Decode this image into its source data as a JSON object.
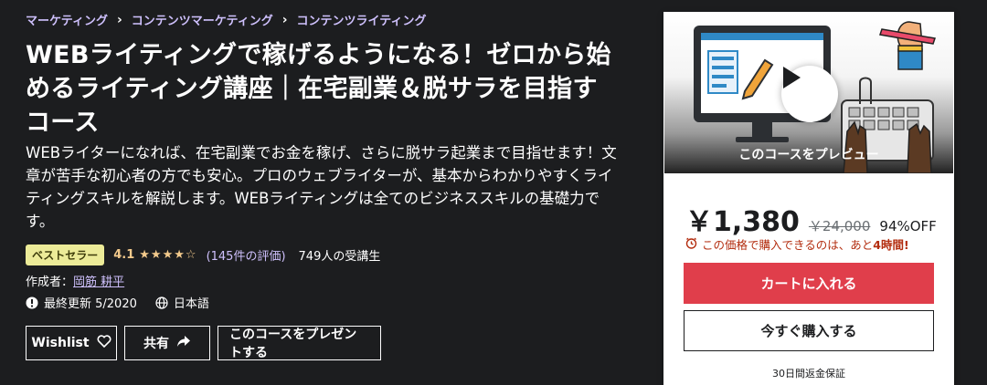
{
  "breadcrumb": [
    "マーケティング",
    "コンテンツマーケティング",
    "コンテンツライティング"
  ],
  "course": {
    "title": "WEBライティングで稼げるようになる！ゼロから始めるライティング講座｜在宅副業＆脱サラを目指すコース",
    "description": "WEBライターになれば、在宅副業でお金を稼げ、さらに脱サラ起業まで目指せます！文章が苦手な初心者の方でも安心。プロのウェブライターが、基本からわかりやすくライティングスキルを解説します。WEBライティングは全てのビジネススキルの基礎力です。",
    "badge": "ベストセラー",
    "rating": "4.1",
    "stars": "★★★★☆",
    "reviews": "(145件の評価)",
    "students": "749人の受講生",
    "author_prefix": "作成者：",
    "author": "岡筋 耕平",
    "updated": "最終更新 5/2020",
    "language": "日本語"
  },
  "actions": {
    "wishlist": "Wishlist",
    "share": "共有",
    "gift": "このコースをプレゼントする"
  },
  "card": {
    "preview_label": "このコースをプレビュー",
    "price": "￥1,380",
    "original_price": "￥24,000",
    "discount": "94%OFF",
    "timer_prefix": "この価格で購入できるのは、あと",
    "timer_hours": "4時間!",
    "add_to_cart": "カートに入れる",
    "buy_now": "今すぐ購入する",
    "guarantee": "30日間返金保証"
  },
  "colors": {
    "background": "#1c1d1f",
    "accent_purple": "#cec0fc",
    "star": "#f3ca8c",
    "badge": "#eceb98",
    "cart": "#e03e4b",
    "timer": "#b32d0f"
  },
  "icons": [
    "chevron-right-icon",
    "star-icon",
    "alert-icon",
    "globe-icon",
    "heart-icon",
    "share-arrow-icon",
    "play-icon",
    "alarm-clock-icon"
  ]
}
